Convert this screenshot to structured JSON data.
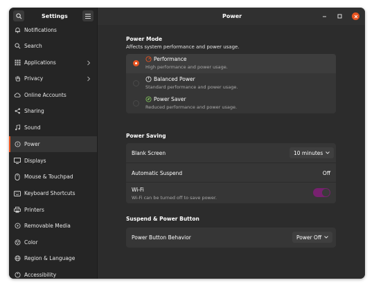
{
  "window": {
    "sidebar_title": "Settings",
    "page_title": "Power",
    "accent_color": "#e95420"
  },
  "sidebar": {
    "items": [
      {
        "label": "Notifications",
        "icon": "bell-icon"
      },
      {
        "label": "Search",
        "icon": "search-icon"
      },
      {
        "label": "Applications",
        "icon": "grid-icon",
        "has_submenu": true
      },
      {
        "label": "Privacy",
        "icon": "hand-icon",
        "has_submenu": true
      },
      {
        "label": "Online Accounts",
        "icon": "cloud-icon"
      },
      {
        "label": "Sharing",
        "icon": "share-icon"
      },
      {
        "label": "Sound",
        "icon": "music-note-icon"
      },
      {
        "label": "Power",
        "icon": "power-icon",
        "active": true
      },
      {
        "label": "Displays",
        "icon": "display-icon"
      },
      {
        "label": "Mouse & Touchpad",
        "icon": "mouse-icon"
      },
      {
        "label": "Keyboard Shortcuts",
        "icon": "keyboard-icon"
      },
      {
        "label": "Printers",
        "icon": "printer-icon"
      },
      {
        "label": "Removable Media",
        "icon": "media-icon"
      },
      {
        "label": "Color",
        "icon": "color-icon"
      },
      {
        "label": "Region & Language",
        "icon": "globe-icon"
      },
      {
        "label": "Accessibility",
        "icon": "accessibility-icon"
      }
    ]
  },
  "power_mode": {
    "title": "Power Mode",
    "subtitle": "Affects system performance and power usage.",
    "modes": [
      {
        "label": "Performance",
        "description": "High performance and power usage.",
        "selected": true,
        "icon": "performance-icon"
      },
      {
        "label": "Balanced Power",
        "description": "Standard performance and power usage.",
        "selected": false,
        "icon": "balanced-icon"
      },
      {
        "label": "Power Saver",
        "description": "Reduced performance and power usage.",
        "selected": false,
        "icon": "leaf-icon"
      }
    ]
  },
  "power_saving": {
    "title": "Power Saving",
    "blank_screen": {
      "label": "Blank Screen",
      "value": "10 minutes"
    },
    "automatic_suspend": {
      "label": "Automatic Suspend",
      "value": "Off"
    },
    "wifi": {
      "label": "Wi-Fi",
      "description": "Wi-Fi can be turned off to save power.",
      "enabled": true
    }
  },
  "suspend_power_button": {
    "title": "Suspend & Power Button",
    "power_button_behavior": {
      "label": "Power Button Behavior",
      "value": "Power Off"
    }
  }
}
